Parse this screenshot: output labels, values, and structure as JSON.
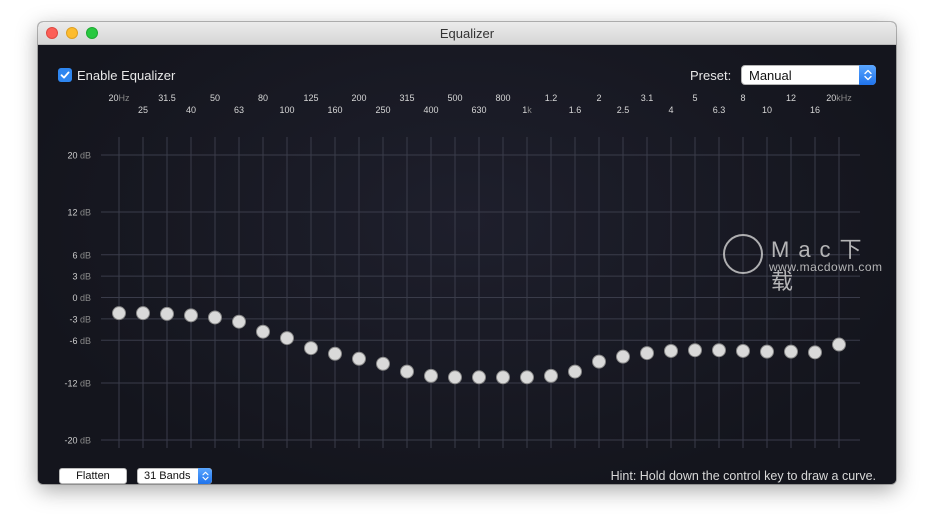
{
  "window": {
    "title": "Equalizer"
  },
  "controls": {
    "enable_label": "Enable Equalizer",
    "enable_checked": true,
    "preset_label": "Preset:",
    "preset_value": "Manual",
    "flatten_label": "Flatten",
    "bands_value": "31 Bands",
    "hint": "Hint: Hold down the control key to draw a curve."
  },
  "colors": {
    "accent": "#2e86f0",
    "background": "#14151d",
    "grid": "#3a3c4a",
    "knob": "#d9d9d9"
  },
  "watermark": {
    "logo_text": "Mac下载",
    "url": "www.macdown.com"
  },
  "eq": {
    "y_ticks": [
      {
        "num": "20",
        "unit": " dB",
        "value": 20
      },
      {
        "num": "12",
        "unit": " dB",
        "value": 12
      },
      {
        "num": "6",
        "unit": " dB",
        "value": 6
      },
      {
        "num": "3",
        "unit": " dB",
        "value": 3
      },
      {
        "num": "0",
        "unit": " dB",
        "value": 0
      },
      {
        "num": "-3",
        "unit": " dB",
        "value": -3
      },
      {
        "num": "-6",
        "unit": " dB",
        "value": -6
      },
      {
        "num": "-12",
        "unit": " dB",
        "value": -12
      },
      {
        "num": "-20",
        "unit": " dB",
        "value": -20
      }
    ],
    "bands": [
      {
        "num": "20",
        "unit": "Hz",
        "gain": -2.2
      },
      {
        "num": "25",
        "unit": "",
        "gain": -2.2
      },
      {
        "num": "31.5",
        "unit": "",
        "gain": -2.3
      },
      {
        "num": "40",
        "unit": "",
        "gain": -2.5
      },
      {
        "num": "50",
        "unit": "",
        "gain": -2.8
      },
      {
        "num": "63",
        "unit": "",
        "gain": -3.4
      },
      {
        "num": "80",
        "unit": "",
        "gain": -4.8
      },
      {
        "num": "100",
        "unit": "",
        "gain": -5.7
      },
      {
        "num": "125",
        "unit": "",
        "gain": -7.1
      },
      {
        "num": "160",
        "unit": "",
        "gain": -7.9
      },
      {
        "num": "200",
        "unit": "",
        "gain": -8.6
      },
      {
        "num": "250",
        "unit": "",
        "gain": -9.3
      },
      {
        "num": "315",
        "unit": "",
        "gain": -10.4
      },
      {
        "num": "400",
        "unit": "",
        "gain": -11
      },
      {
        "num": "500",
        "unit": "",
        "gain": -11.2
      },
      {
        "num": "630",
        "unit": "",
        "gain": -11.2
      },
      {
        "num": "800",
        "unit": "",
        "gain": -11.2
      },
      {
        "num": "1",
        "unit": "k",
        "gain": -11.2
      },
      {
        "num": "1.2",
        "unit": "",
        "gain": -11
      },
      {
        "num": "1.6",
        "unit": "",
        "gain": -10.4
      },
      {
        "num": "2",
        "unit": "",
        "gain": -9
      },
      {
        "num": "2.5",
        "unit": "",
        "gain": -8.3
      },
      {
        "num": "3.1",
        "unit": "",
        "gain": -7.8
      },
      {
        "num": "4",
        "unit": "",
        "gain": -7.5
      },
      {
        "num": "5",
        "unit": "",
        "gain": -7.4
      },
      {
        "num": "6.3",
        "unit": "",
        "gain": -7.4
      },
      {
        "num": "8",
        "unit": "",
        "gain": -7.5
      },
      {
        "num": "10",
        "unit": "",
        "gain": -7.6
      },
      {
        "num": "12",
        "unit": "",
        "gain": -7.6
      },
      {
        "num": "16",
        "unit": "",
        "gain": -7.7
      },
      {
        "num": "20",
        "unit": "kHz",
        "gain": -6.6
      }
    ],
    "ylim": [
      -20,
      20
    ]
  }
}
